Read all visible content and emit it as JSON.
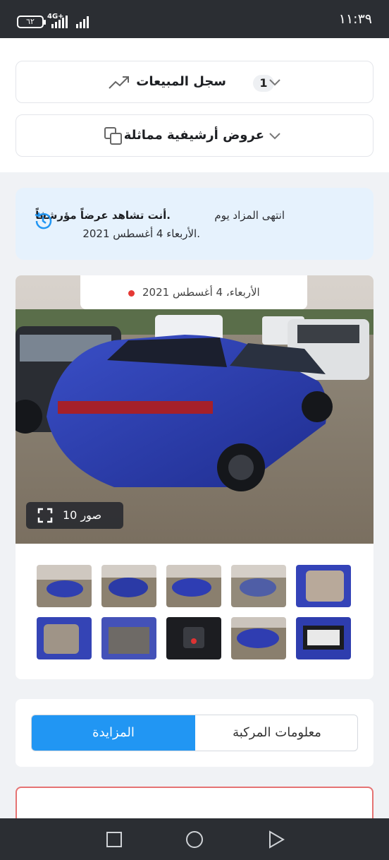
{
  "status_bar": {
    "time": "١١:٣٩",
    "battery": "٦٢",
    "network": "4G+"
  },
  "sales_history": {
    "label": "سجل المبيعات",
    "count": "1",
    "icon": "trending-up-icon"
  },
  "similar_archived": {
    "label": "عروض أرشيفية مماثلة",
    "icon": "copy-icon"
  },
  "auction_notice": {
    "prefix": "انتهى المزاد يوم",
    "bold": "أنت تشاهد عرضاً مؤرشفاً.",
    "date_line": "الأربعاء 4 أغسطس 2021.",
    "icon": "history-icon"
  },
  "gallery": {
    "date_label": "الأربعاء، 4 أغسطس 2021",
    "photo_count": "10 صور",
    "thumbnail_count": 10
  },
  "tabs": {
    "auction": "المزايدة",
    "vehicle_info": "معلومات المركبة"
  },
  "colors": {
    "accent": "#2196f3",
    "info_bg": "#e6f2fd",
    "live_dot": "#e53935"
  }
}
